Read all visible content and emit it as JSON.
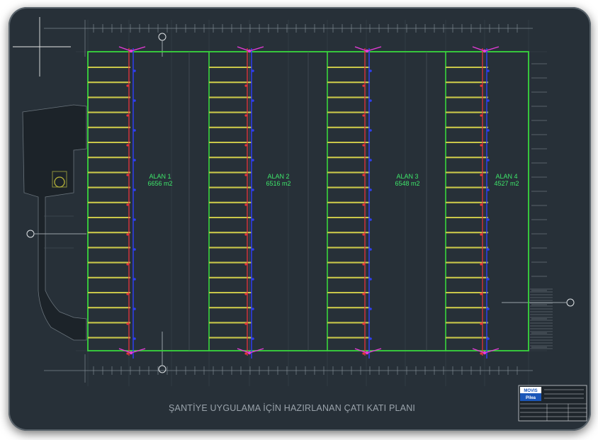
{
  "drawing_title": "ŞANTİYE UYGULAMA İÇİN HAZIRLANAN ÇATI KATI PLANI",
  "areas": [
    {
      "name": "ALAN 1",
      "area": "6656 m2"
    },
    {
      "name": "ALAN 2",
      "area": "6516 m2"
    },
    {
      "name": "ALAN 3",
      "area": "6548 m2"
    },
    {
      "name": "ALAN 4",
      "area": "4527 m2"
    }
  ],
  "title_block": {
    "logo_line1": "MOVIS",
    "logo_line2": "Pilea"
  },
  "colors": {
    "background": "#273038",
    "outline": "#39d63c",
    "beams": "#c9c64a",
    "supply_pipe": "#e8343a",
    "return_pipe": "#2f3ef0",
    "drains": "#e63bd8",
    "area_text": "#3ee66a"
  }
}
